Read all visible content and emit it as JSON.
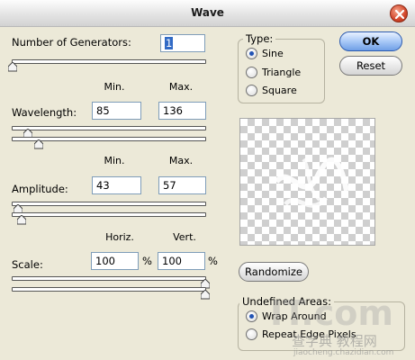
{
  "window": {
    "title": "Wave"
  },
  "generators": {
    "label": "Number of Generators:",
    "value": "1",
    "slider_fraction": 0.0
  },
  "headers": {
    "min": "Min.",
    "max": "Max.",
    "horiz": "Horiz.",
    "vert": "Vert."
  },
  "wavelength": {
    "label": "Wavelength:",
    "min": "85",
    "max": "136"
  },
  "amplitude": {
    "label": "Amplitude:",
    "min": "43",
    "max": "57"
  },
  "scale": {
    "label": "Scale:",
    "horiz": "100",
    "vert": "100",
    "unit": "%"
  },
  "type_group": {
    "label": "Type:",
    "options": [
      {
        "label": "Sine",
        "selected": true
      },
      {
        "label": "Triangle",
        "selected": false
      },
      {
        "label": "Square",
        "selected": false
      }
    ]
  },
  "buttons": {
    "ok": "OK",
    "reset": "Reset",
    "randomize": "Randomize"
  },
  "undefined_areas": {
    "label": "Undefined Areas:",
    "options": [
      {
        "label": "Wrap Around",
        "selected": true
      },
      {
        "label": "Repeat Edge Pixels",
        "selected": false
      }
    ]
  },
  "watermark": {
    "logo": "IT.com",
    "cn": "查字典 教程网",
    "url": "jiaocheng.chazidian.com"
  },
  "colors": {
    "accent": "#316ac5",
    "radio_dot": "#2153b4",
    "background": "#ece9d8"
  }
}
